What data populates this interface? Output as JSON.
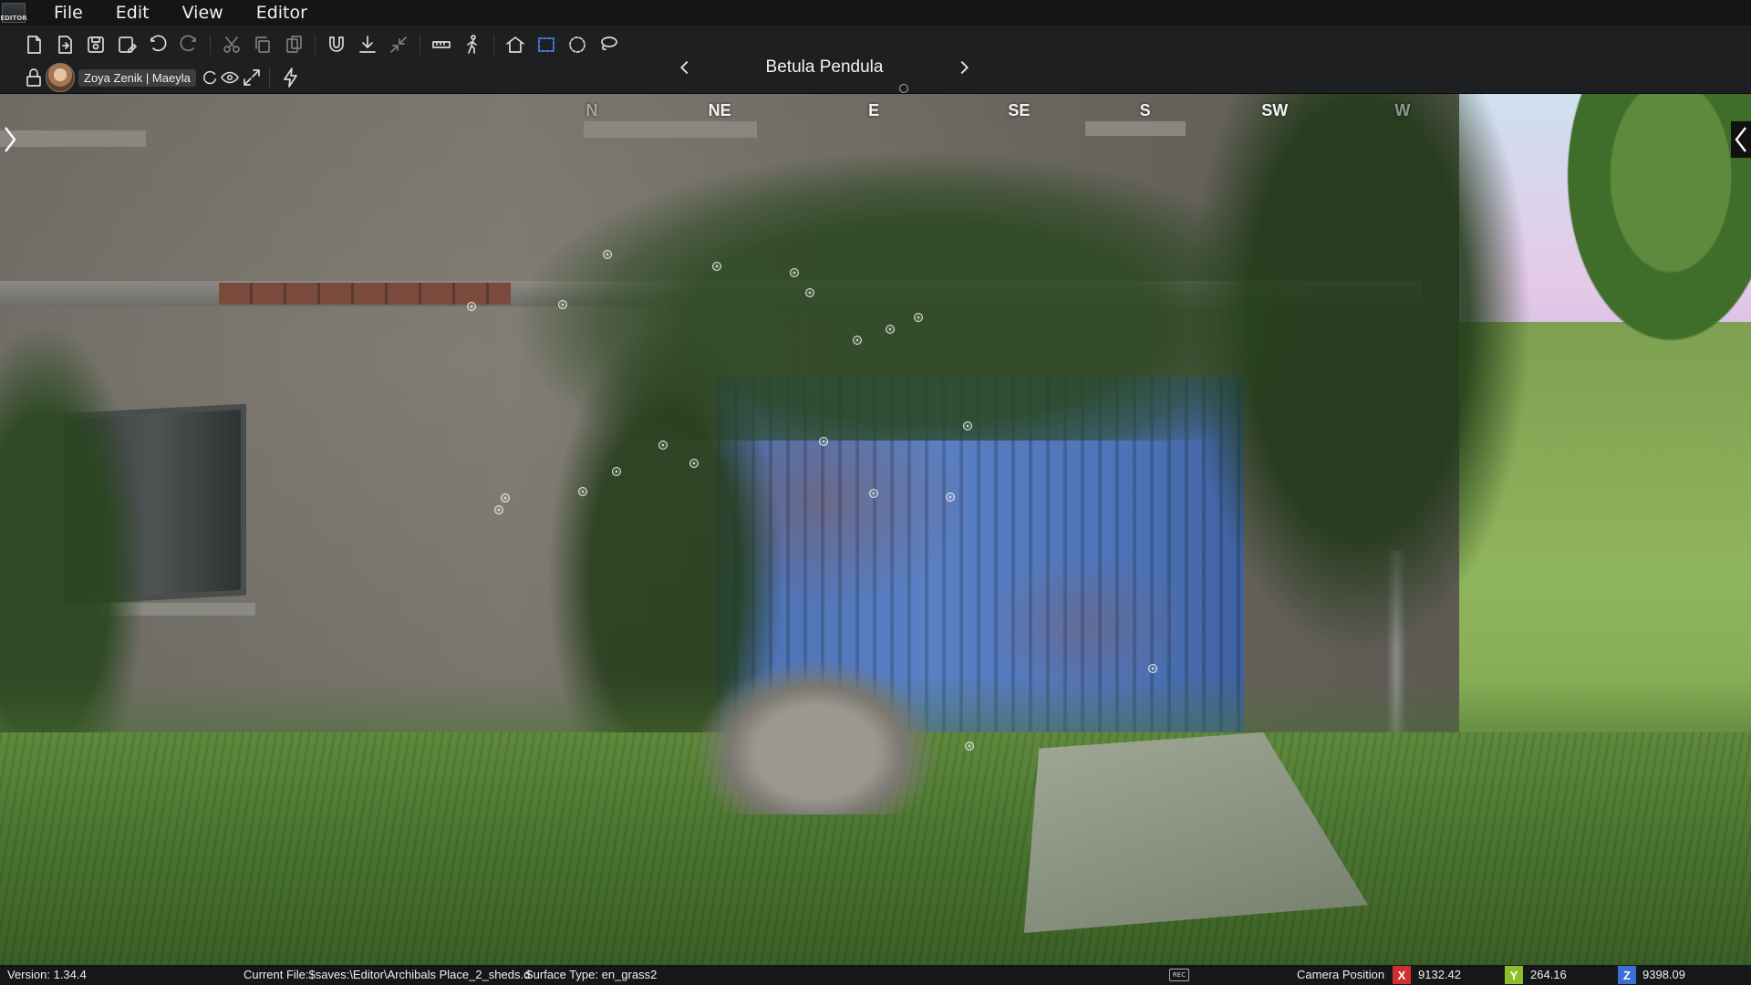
{
  "menu": {
    "logo_text": "EDITOR",
    "items": [
      "File",
      "Edit",
      "View",
      "Editor"
    ]
  },
  "toolbar": {
    "row1": [
      "new-file-icon",
      "open-file-icon",
      "save-icon",
      "save-as-icon",
      "undo-icon",
      "redo-icon",
      "cut-icon",
      "copy-icon",
      "paste-icon",
      "magnet-snap-icon",
      "drop-to-ground-icon",
      "collapse-icon",
      "measure-icon",
      "walk-mode-icon",
      "home-icon",
      "rectangle-select-icon",
      "circle-select-icon",
      "lasso-select-icon"
    ],
    "row2": [
      "lock-icon",
      "sync-icon",
      "visibility-icon",
      "expand-icon",
      "lightning-icon"
    ],
    "selected_tool": "rectangle-select-icon"
  },
  "entity_nav": {
    "name": "Betula Pendula"
  },
  "user": {
    "tag": "Zoya Zenik | Maeyla"
  },
  "compass": {
    "labels": [
      {
        "text": "N",
        "x_pct": 33.8,
        "fade": true
      },
      {
        "text": "NE",
        "x_pct": 41.1,
        "fade": false
      },
      {
        "text": "E",
        "x_pct": 49.9,
        "fade": false
      },
      {
        "text": "SE",
        "x_pct": 58.2,
        "fade": false
      },
      {
        "text": "S",
        "x_pct": 65.4,
        "fade": false
      },
      {
        "text": "SW",
        "x_pct": 72.8,
        "fade": false
      },
      {
        "text": "W",
        "x_pct": 80.1,
        "fade": true
      }
    ]
  },
  "status": {
    "version": "Version:  1.34.4",
    "current_file": "Current File:$saves:\\Editor\\Archibals Place_2_sheds.d",
    "surface_type": "Surface Type: en_grass2",
    "camera_label": "Camera Position",
    "x_label": "X",
    "x_value": "9132.42",
    "y_label": "Y",
    "y_value": "264.16",
    "z_label": "Z",
    "z_value": "9398.09",
    "x_color": "#d12f2f",
    "y_color": "#8bbf2a",
    "z_color": "#3b6fd6"
  }
}
